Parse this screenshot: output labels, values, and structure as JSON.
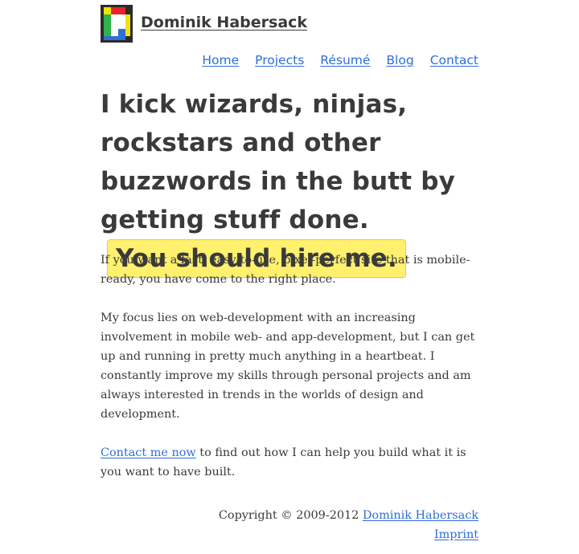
{
  "header": {
    "brand_name": "Dominik Habersack",
    "logo_icon": "pixel-d-logo-icon"
  },
  "nav": {
    "items": [
      {
        "label": "Home"
      },
      {
        "label": "Projects"
      },
      {
        "label": "Résumé"
      },
      {
        "label": "Blog"
      },
      {
        "label": "Contact"
      }
    ]
  },
  "hero": {
    "headline": "I kick wizards, ninjas, rockstars and other buzzwords in the butt by getting stuff done.",
    "cta_label": "You should hire me."
  },
  "content": {
    "paragraph_1": "If you want a fast, easy-to-use, pixel-perfect site that is mobile-ready, you have come to the right place.",
    "paragraph_2": "My focus lies on web-development with an increasing involvement in mobile web- and app-development, but I can get up and running in pretty much anything in a heartbeat. I constantly improve my skills through personal projects and am always interested in trends in the worlds of design and development.",
    "contact_link": "Contact me now",
    "paragraph_3_rest": " to find out how I can help you build what it is you want to have built."
  },
  "footer": {
    "copyright": "Copyright © 2009-2012 ",
    "author_link": "Dominik Habersack",
    "imprint_link": "Imprint"
  },
  "colors": {
    "link": "#2f6fd6",
    "text": "#3a3a3a",
    "highlight": "#fff06e"
  }
}
